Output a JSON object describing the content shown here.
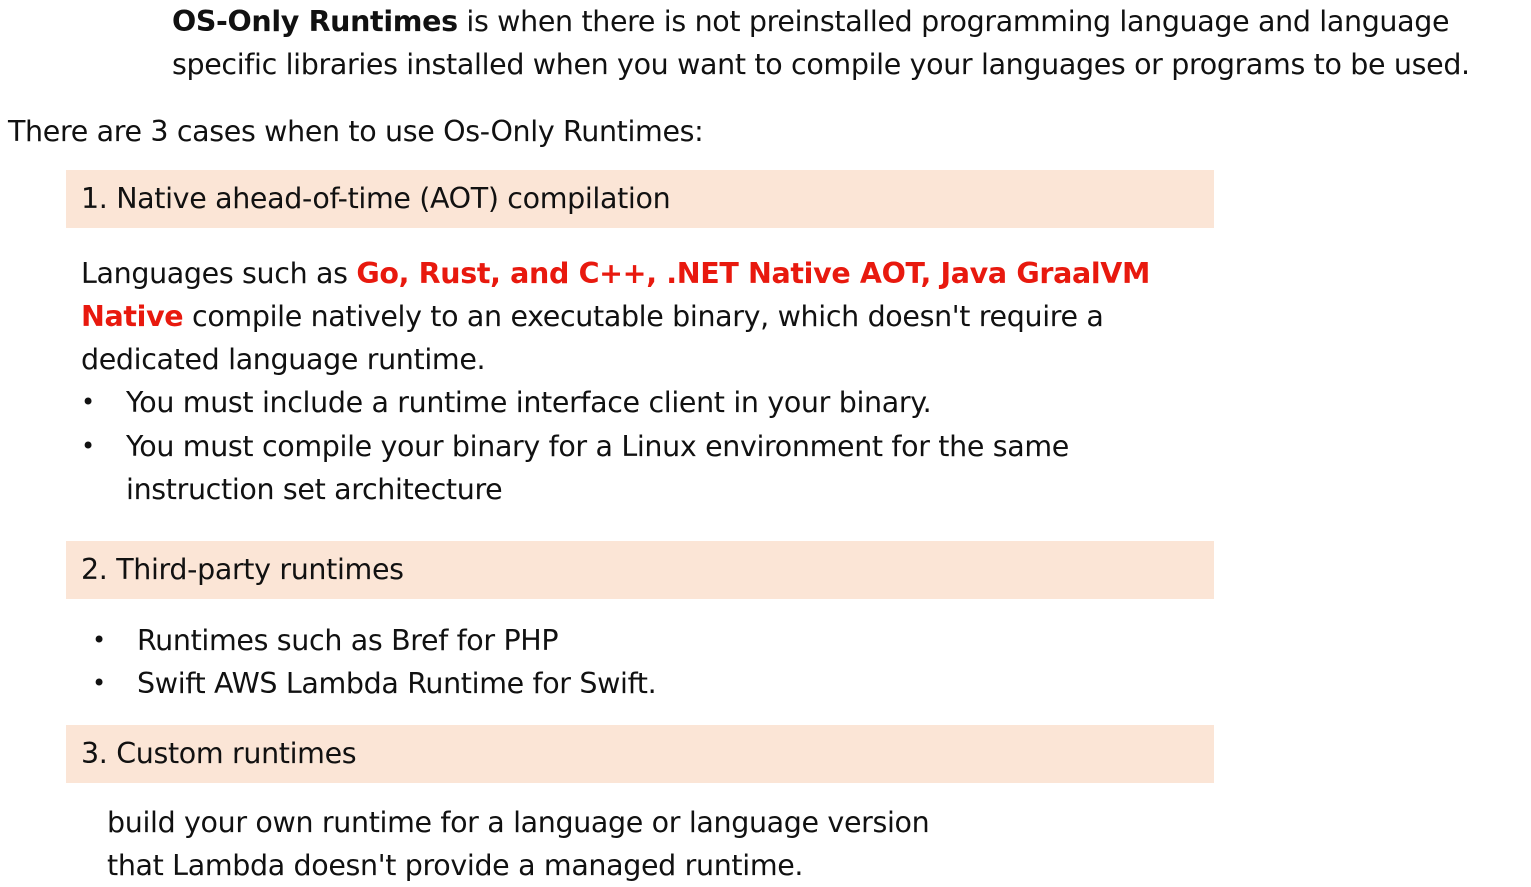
{
  "intro": {
    "term": "OS-Only Runtimes",
    "text": " is when there is not preinstalled programming language and language specific libraries installed when you want to compile your languages or programs to be used."
  },
  "lead": "There are 3 cases when to use Os-Only Runtimes:",
  "sections": [
    {
      "heading": "1. Native ahead-of-time (AOT) compilation",
      "text_before": "Languages such as ",
      "highlight": "Go, Rust, and C++, .NET Native AOT, Java GraalVM Native",
      "text_after": " compile natively to an executable binary, which doesn't require a dedicated language runtime.",
      "bullets": [
        "You must include a runtime interface client in your binary.",
        "You must compile your binary for a Linux environment for the same instruction set architecture"
      ]
    },
    {
      "heading": "2. Third-party runtimes",
      "bullets": [
        "Runtimes such as Bref for PHP",
        "Swift AWS Lambda Runtime for Swift."
      ]
    },
    {
      "heading": "3. Custom runtimes",
      "lines": [
        "build your own runtime for a language or language version",
        "that Lambda doesn't provide a managed runtime."
      ]
    }
  ],
  "bullet_glyph": "•",
  "colors": {
    "band": "#fbe5d6",
    "highlight": "#e8190e",
    "text": "#111111"
  }
}
